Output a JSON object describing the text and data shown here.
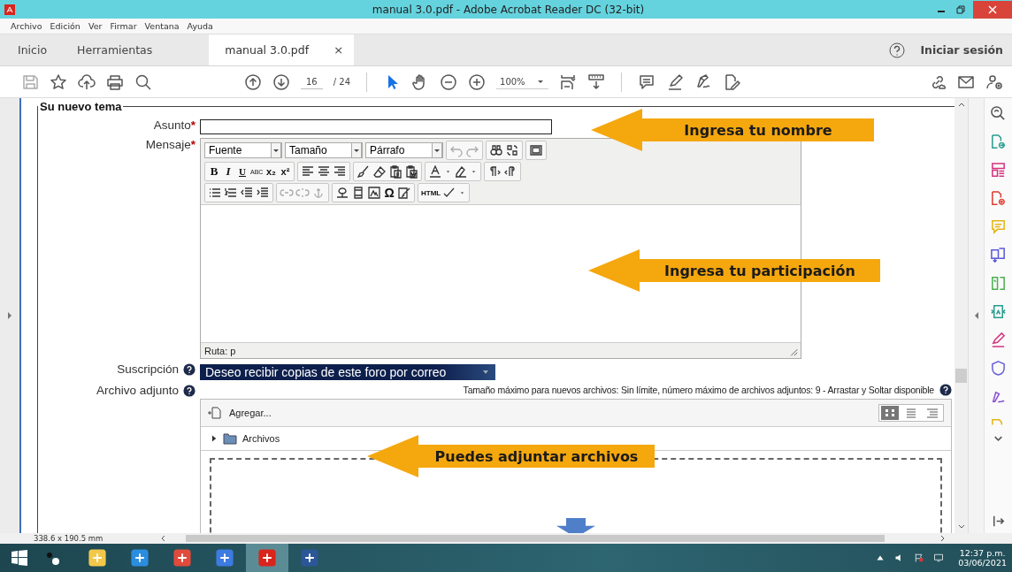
{
  "window": {
    "title": "manual 3.0.pdf - Adobe Acrobat Reader DC (32-bit)"
  },
  "menu": [
    "Archivo",
    "Edición",
    "Ver",
    "Firmar",
    "Ventana",
    "Ayuda"
  ],
  "tabs": [
    {
      "label": "Inicio",
      "selected": false
    },
    {
      "label": "Herramientas",
      "selected": false
    },
    {
      "label": "manual 3.0.pdf",
      "selected": true,
      "close": "×"
    }
  ],
  "sign_in": "Iniciar sesión",
  "toolbar": {
    "page": "16",
    "page_count": "/ 24",
    "zoom": "100%"
  },
  "form": {
    "legend": "Su nuevo tema",
    "subject": {
      "label": "Asunto",
      "required": "*"
    },
    "message": {
      "label": "Mensaje",
      "required": "*"
    },
    "editor": {
      "dropdowns": [
        "Fuente",
        "Tamaño",
        "Párrafo"
      ],
      "format": [
        "B",
        "I",
        "U",
        "ABC",
        "x₂",
        "x²"
      ],
      "special": "Ω",
      "html": "HTML",
      "path": "Ruta: p"
    },
    "subscription": {
      "label": "Suscripción",
      "value": "Deseo recibir copias de este foro por correo"
    },
    "attachment": {
      "label": "Archivo adjunto",
      "info": "Tamaño máximo para nuevos archivos: Sin límite, número máximo de archivos adjuntos: 9 - Arrastar y Soltar disponible",
      "add": "Agregar...",
      "folder": "Archivos",
      "folder_expanded": false
    }
  },
  "callouts": [
    "Ingresa tu nombre",
    "Ingresa tu participación",
    "Puedes adjuntar archivos"
  ],
  "status": {
    "page_size": "338.6 x 190.5 mm"
  },
  "taskbar": {
    "apps": [
      {
        "selected": false
      },
      {
        "selected": false
      },
      {
        "selected": false
      },
      {
        "selected": false
      },
      {
        "selected": true
      },
      {
        "selected": false
      }
    ],
    "time": "12:37 p.m.",
    "date": "03/06/2021"
  }
}
